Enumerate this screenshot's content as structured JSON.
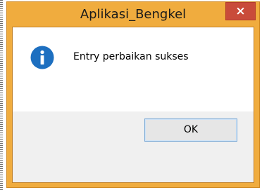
{
  "window": {
    "title": "Aplikasi_Bengkel",
    "close_glyph": "×"
  },
  "message": {
    "icon": "information-icon",
    "text": "Entry perbaikan sukses"
  },
  "buttons": {
    "ok_label": "OK"
  },
  "colors": {
    "frame": "#f0ac3e",
    "close_button": "#c94b3a",
    "info_icon": "#1d6fc0",
    "button_border": "#7aa9d6"
  }
}
